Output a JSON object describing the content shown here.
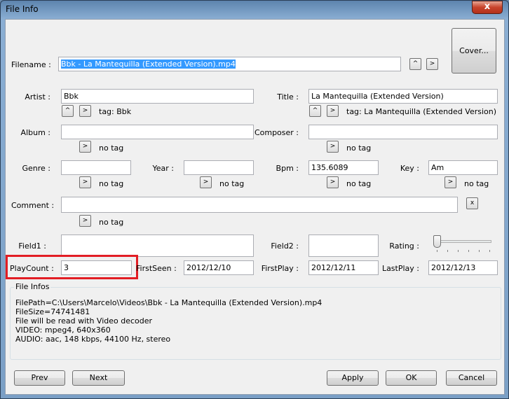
{
  "window": {
    "title": "File Info",
    "close_label": "x"
  },
  "filename": {
    "label": "Filename :",
    "value": "Bbk - La Mantequilla (Extended Version).mp4",
    "up": "^",
    "right": ">"
  },
  "cover_button": "Cover...",
  "artist": {
    "label": "Artist :",
    "value": "Bbk",
    "tag": "tag: Bbk"
  },
  "title_field": {
    "label": "Title :",
    "value": "La Mantequilla (Extended Version)",
    "tag": "tag: La Mantequilla (Extended Version)"
  },
  "album": {
    "label": "Album :",
    "value": "",
    "tag": "no tag"
  },
  "composer": {
    "label": "Composer :",
    "value": "",
    "tag": "no tag"
  },
  "genre": {
    "label": "Genre :",
    "value": "",
    "tag": "no tag"
  },
  "year": {
    "label": "Year :",
    "value": "",
    "tag": "no tag"
  },
  "bpm": {
    "label": "Bpm :",
    "value": "135.6089",
    "tag": "no tag"
  },
  "key": {
    "label": "Key :",
    "value": "Am",
    "tag": "no tag"
  },
  "comment": {
    "label": "Comment :",
    "value": "",
    "tag": "no tag",
    "clear": "x"
  },
  "field1": {
    "label": "Field1 :",
    "value": ""
  },
  "field2": {
    "label": "Field2 :",
    "value": ""
  },
  "rating": {
    "label": "Rating :",
    "value": 0
  },
  "playcount": {
    "label": "PlayCount :",
    "value": "3"
  },
  "firstseen": {
    "label": "FirstSeen :",
    "value": "2012/12/10"
  },
  "firstplay": {
    "label": "FirstPlay :",
    "value": "2012/12/11"
  },
  "lastplay": {
    "label": "LastPlay :",
    "value": "2012/12/13"
  },
  "file_infos": {
    "title": "File Infos",
    "lines": [
      "FilePath=C:\\Users\\Marcelo\\Videos\\Bbk - La Mantequilla (Extended Version).mp4",
      "FileSize=74741481",
      "File will be read with Video decoder",
      "VIDEO: mpeg4, 640x360",
      "AUDIO: aac, 148 kbps, 44100 Hz, stereo"
    ]
  },
  "buttons": {
    "prev": "Prev",
    "next": "Next",
    "apply": "Apply",
    "ok": "OK",
    "cancel": "Cancel"
  },
  "arrows": {
    "up": "^",
    "right": ">"
  },
  "colors": {
    "highlight": "#e21d24",
    "selection": "#3399ff"
  }
}
